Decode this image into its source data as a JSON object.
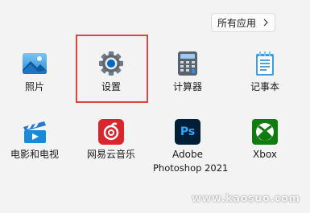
{
  "all_apps_button": {
    "label": "所有应用",
    "chevron_icon": "chevron-right-icon"
  },
  "pinned_apps": [
    {
      "label": "照片",
      "icon": "photos-icon"
    },
    {
      "label": "设置",
      "icon": "settings-gear-icon"
    },
    {
      "label": "计算器",
      "icon": "calculator-icon"
    },
    {
      "label": "记事本",
      "icon": "notepad-icon"
    },
    {
      "label": "电影和电视",
      "icon": "movies-tv-icon"
    },
    {
      "label": "网易云音乐",
      "icon": "netease-music-icon"
    },
    {
      "label": "Adobe",
      "label_line2": "Photoshop 2021",
      "icon": "photoshop-icon",
      "icon_text": "Ps"
    },
    {
      "label": "Xbox",
      "icon": "xbox-icon"
    }
  ],
  "watermark": "www.kaosuo.com",
  "colors": {
    "highlight_border": "#d9473e",
    "settings_blue": "#0067c0",
    "netease_red": "#d9262c",
    "photoshop_bg": "#001e36",
    "photoshop_text": "#31a8ff",
    "xbox_green": "#107c10"
  }
}
